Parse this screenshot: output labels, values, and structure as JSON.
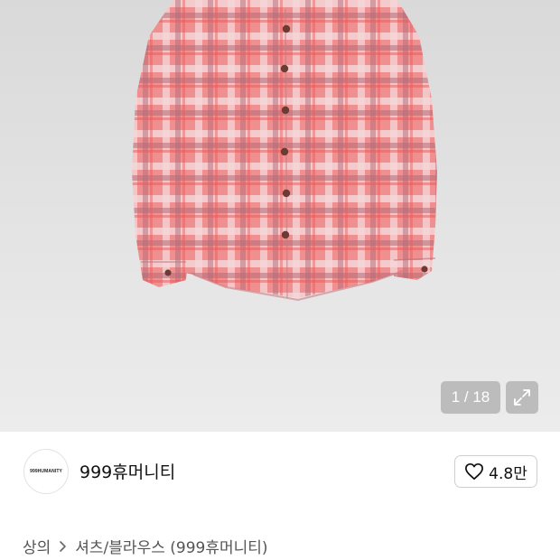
{
  "gallery": {
    "counter": "1 / 18",
    "expand_icon": "expand-icon",
    "shirt_colors": {
      "base": "#ef8f8f",
      "dark": "#b86a74",
      "light": "#f4d4d6",
      "button": "#6b3b34"
    }
  },
  "brand": {
    "logo_text": "999HUMANITY",
    "name": "999휴머니티"
  },
  "like": {
    "icon": "heart-icon",
    "count": "4.8만"
  },
  "breadcrumb": {
    "category": "상의",
    "subcategory": "셔츠/블라우스 (999휴머니티)",
    "separator_icon": "chevron-right-icon"
  }
}
